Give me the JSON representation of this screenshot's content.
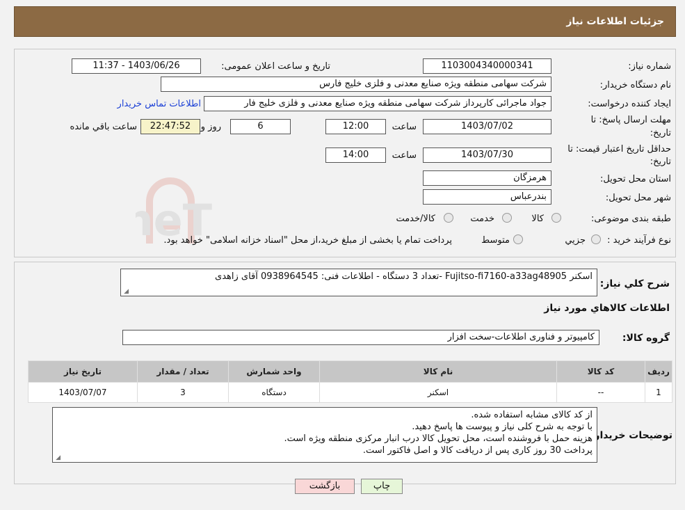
{
  "header": {
    "title": "جزئیات اطلاعات نیاز"
  },
  "form": {
    "need_number_label": "شماره نیاز:",
    "need_number": "1103004340000341",
    "announce_label": "تاریخ و ساعت اعلان عمومی:",
    "announce_value": "1403/06/26 - 11:37",
    "buyer_org_label": "نام دستگاه خریدار:",
    "buyer_org": "شرکت سهامی منطقه ویژه صنایع معدنی و فلزی خلیج فارس",
    "creator_label": "ایجاد کننده درخواست:",
    "creator": "جواد ماجرائی کارپرداز شرکت سهامی منطقه ویژه صنایع معدنی و فلزی خلیج فار",
    "contact_link": "اطلاعات تماس خریدار",
    "deadline_label_1": "مهلت ارسال پاسخ: تا",
    "deadline_label_2": "تاریخ:",
    "deadline_date": "1403/07/02",
    "time_label": "ساعت",
    "deadline_time": "12:00",
    "days_value": "6",
    "days_label": "روز و",
    "remaining_time": "22:47:52",
    "remaining_label": "ساعت باقي مانده",
    "validity_label_1": "حداقل تاریخ اعتبار قیمت: تا",
    "validity_label_2": "تاریخ:",
    "validity_date": "1403/07/30",
    "validity_time": "14:00",
    "province_label": "استان محل تحویل:",
    "province": "هرمزگان",
    "city_label": "شهر محل تحویل:",
    "city": "بندرعباس",
    "category_label": "طبقه بندی موضوعی:",
    "category_options": [
      "کالا",
      "خدمت",
      "کالا/خدمت"
    ],
    "process_label": "نوع فرآیند خرید :",
    "process_options": [
      "جزیي",
      "متوسط"
    ],
    "process_note": "پرداخت تمام یا بخشی از مبلغ خرید،از محل \"اسناد خزانه اسلامی\" خواهد بود."
  },
  "summary": {
    "label": "شرح کلي نياز:",
    "text": "اسکنر Fujitso-fi7160-a33ag48905 -تعداد 3 دستگاه - اطلاعات فنی: 0938964545 آقای زاهدی",
    "goods_title": "اطلاعات کالاهاي مورد نياز",
    "group_label": "گروه کالا:",
    "group_value": "کامپیوتر و فناوری اطلاعات-سخت افزار"
  },
  "table": {
    "headers": [
      "رديف",
      "کد کالا",
      "نام کالا",
      "واحد شمارش",
      "تعداد / مقدار",
      "تاریخ نیاز"
    ],
    "rows": [
      [
        "1",
        "--",
        "اسکنر",
        "دستگاه",
        "3",
        "1403/07/07"
      ]
    ]
  },
  "notes": {
    "label": "توضیحات خریدار:",
    "lines": [
      "از کد کالای مشابه استفاده شده.",
      "با توجه به شرح کلی نیاز و پیوست ها پاسخ دهید.",
      "هزینه حمل با فروشنده است، محل تحویل کالا درب انبار مرکزی منطقه ویژه است.",
      "پرداخت 30 روز کاری پس از دریافت کالا و اصل فاکتور است."
    ]
  },
  "buttons": {
    "print": "چاپ",
    "back": "بازگشت"
  },
  "watermark": {
    "text": "AriaTender.neT"
  },
  "colors": {
    "header_bg": "#8c6a44",
    "link": "#1a3fd6",
    "back_btn": "#f9d7d7",
    "print_btn": "#e6f6d8"
  }
}
